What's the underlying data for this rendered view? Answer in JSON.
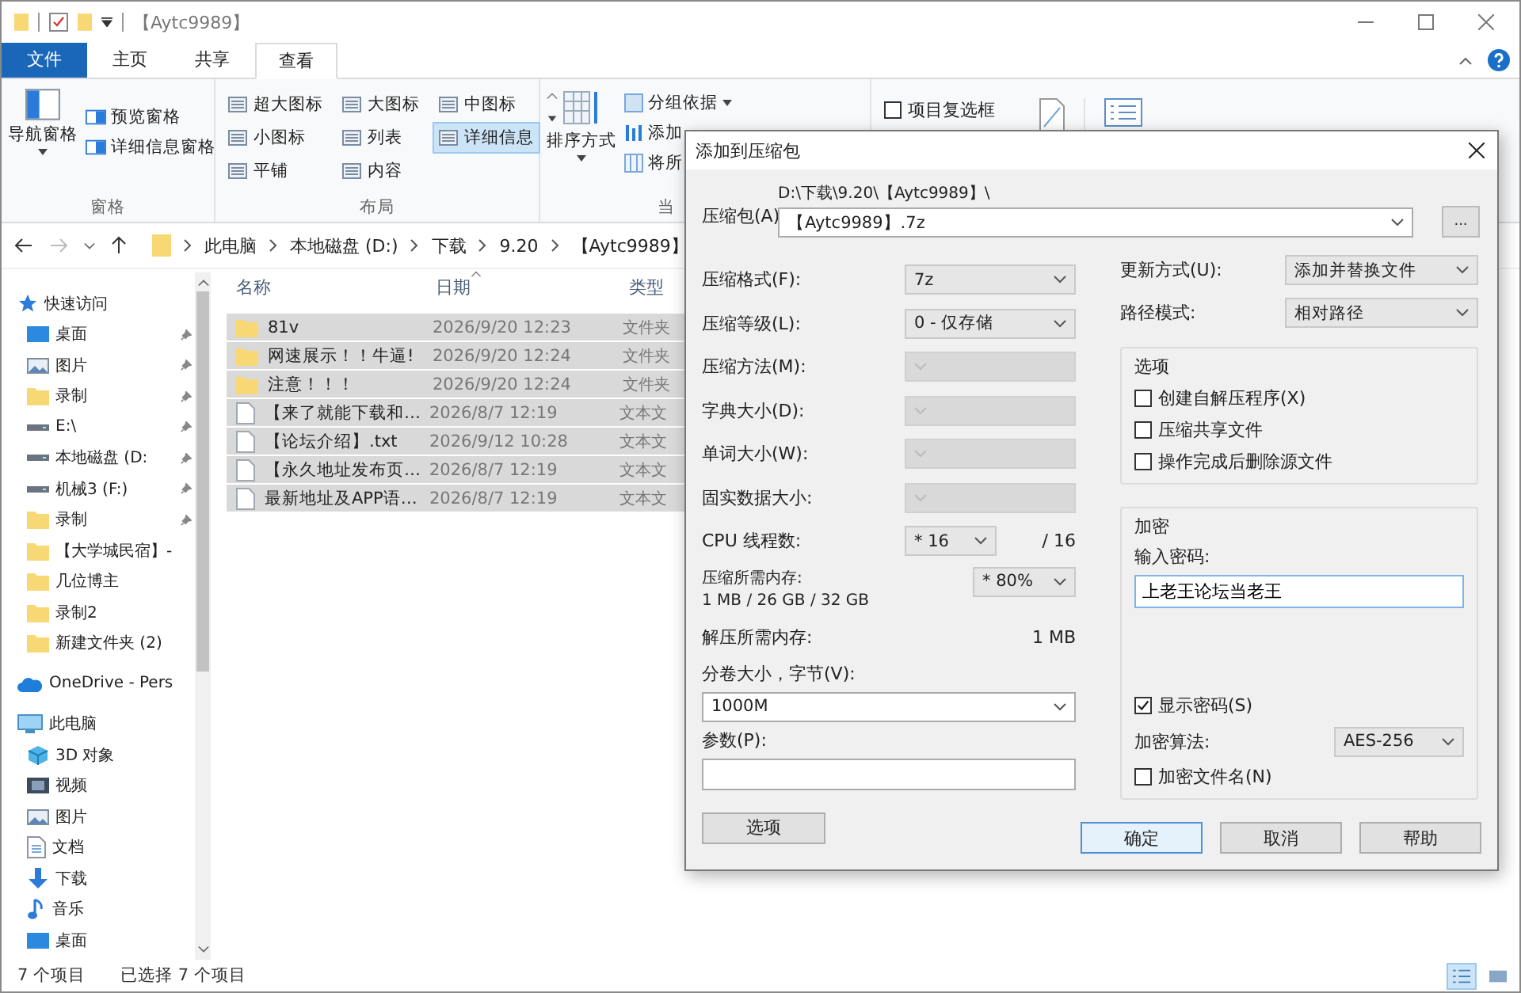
{
  "window": {
    "title": "【Aytc9989】"
  },
  "ribbon_tabs": [
    {
      "label": "文件",
      "selected": false,
      "kind": "file"
    },
    {
      "label": "主页",
      "selected": false,
      "kind": "tab"
    },
    {
      "label": "共享",
      "selected": false,
      "kind": "tab"
    },
    {
      "label": "查看",
      "selected": true,
      "kind": "tab"
    }
  ],
  "ribbon": {
    "pane_group": {
      "label": "窗格",
      "navigation_pane": "导航窗格",
      "preview_pane": "预览窗格",
      "details_pane": "详细信息窗格"
    },
    "layout_group": {
      "label": "布局",
      "options": [
        {
          "label": "超大图标",
          "selected": false
        },
        {
          "label": "大图标",
          "selected": false
        },
        {
          "label": "中图标",
          "selected": false
        },
        {
          "label": "小图标",
          "selected": false
        },
        {
          "label": "列表",
          "selected": false
        },
        {
          "label": "详细信息",
          "selected": true
        },
        {
          "label": "平铺",
          "selected": false
        },
        {
          "label": "内容",
          "selected": false
        }
      ]
    },
    "current_view_group": {
      "label": "当",
      "sort_by": "排序方式",
      "group_by": "分组依据",
      "add_column": "添加",
      "size_columns": "将所"
    },
    "item_checkboxes": {
      "label": "项目复选框",
      "checked": false
    }
  },
  "address_bar": {
    "path": [
      "此电脑",
      "本地磁盘 (D:)",
      "下载",
      "9.20",
      "【Aytc9989】"
    ]
  },
  "navigation_pane": {
    "items": [
      {
        "label": "快速访问",
        "kind": "star",
        "children": [
          {
            "label": "桌面",
            "kind": "desktop",
            "pinned": true
          },
          {
            "label": "图片",
            "kind": "pictures",
            "pinned": true
          },
          {
            "label": "录制",
            "kind": "folder",
            "pinned": true
          },
          {
            "label": "E:\\",
            "kind": "drive",
            "pinned": true
          },
          {
            "label": "本地磁盘 (D:",
            "kind": "drive",
            "pinned": true
          },
          {
            "label": "机械3 (F:)",
            "kind": "drive",
            "pinned": true
          },
          {
            "label": "录制",
            "kind": "folder",
            "pinned": true
          },
          {
            "label": "【大学城民宿】-",
            "kind": "folder",
            "pinned": false
          },
          {
            "label": "几位博主",
            "kind": "folder",
            "pinned": false
          },
          {
            "label": "录制2",
            "kind": "folder",
            "pinned": false
          },
          {
            "label": "新建文件夹 (2)",
            "kind": "folder",
            "pinned": false
          }
        ]
      },
      {
        "label": "OneDrive - Pers",
        "kind": "cloud"
      },
      {
        "label": "此电脑",
        "kind": "pc",
        "children": [
          {
            "label": "3D 对象",
            "kind": "cube"
          },
          {
            "label": "视频",
            "kind": "video"
          },
          {
            "label": "图片",
            "kind": "pictures"
          },
          {
            "label": "文档",
            "kind": "document"
          },
          {
            "label": "下载",
            "kind": "download"
          },
          {
            "label": "音乐",
            "kind": "music"
          },
          {
            "label": "桌面",
            "kind": "desktop"
          }
        ]
      }
    ]
  },
  "file_list": {
    "columns": [
      "名称",
      "日期",
      "类型"
    ],
    "rows": [
      {
        "name": "81v",
        "date": "2026/9/20 12:23",
        "type": "文件夹",
        "kind": "folder",
        "selected": true
      },
      {
        "name": "网速展示！！牛逼!",
        "date": "2026/9/20 12:24",
        "type": "文件夹",
        "kind": "folder",
        "selected": true
      },
      {
        "name": "注意！！！",
        "date": "2026/9/20 12:24",
        "type": "文件夹",
        "kind": "folder",
        "selected": true
      },
      {
        "name": "【来了就能下载和…",
        "date": "2026/8/7 12:19",
        "type": "文本文",
        "kind": "text",
        "selected": true
      },
      {
        "name": "【论坛介绍】.txt",
        "date": "2026/9/12 10:28",
        "type": "文本文",
        "kind": "text",
        "selected": true
      },
      {
        "name": "【永久地址发布页…",
        "date": "2026/8/7 12:19",
        "type": "文本文",
        "kind": "text",
        "selected": true
      },
      {
        "name": "最新地址及APP语…",
        "date": "2026/8/7 12:19",
        "type": "文本文",
        "kind": "text",
        "selected": true
      }
    ]
  },
  "status_bar": {
    "item_count": "7 个项目",
    "selection": "已选择 7 个项目",
    "views": [
      {
        "kind": "details",
        "selected": true
      },
      {
        "kind": "thumbnails",
        "selected": false
      }
    ]
  },
  "dialog": {
    "title": "添加到压缩包",
    "archive": {
      "label": "压缩包(A)",
      "folder": "D:\\下载\\9.20\\【Aytc9989】\\",
      "name": "【Aytc9989】.7z",
      "browse": "..."
    },
    "left_fields": [
      {
        "label": "压缩格式(F):",
        "value": "7z",
        "disabled": false
      },
      {
        "label": "压缩等级(L):",
        "value": "0 - 仅存储",
        "disabled": false
      },
      {
        "label": "压缩方法(M):",
        "disabled": true
      },
      {
        "label": "字典大小(D):",
        "disabled": true
      },
      {
        "label": "单词大小(W):",
        "disabled": true
      },
      {
        "label": "固实数据大小:",
        "disabled": true
      }
    ],
    "cpu_threads": {
      "label": "CPU 线程数:",
      "value": "* 16",
      "max": "/ 16"
    },
    "compress_memory": {
      "label": "压缩所需内存:",
      "detail": "1 MB / 26 GB / 32 GB",
      "value": "* 80%"
    },
    "decompress_memory": {
      "label": "解压所需内存:",
      "value": "1 MB"
    },
    "volume_size": {
      "label": "分卷大小，字节(V):",
      "value": "1000M"
    },
    "parameters": {
      "label": "参数(P):"
    },
    "options_button": "选项",
    "update_mode": {
      "label": "更新方式(U):",
      "value": "添加并替换文件"
    },
    "path_mode": {
      "label": "路径模式:",
      "value": "相对路径"
    },
    "options": {
      "label": "选项",
      "items": [
        {
          "label": "创建自解压程序(X)",
          "checked": false
        },
        {
          "label": "压缩共享文件",
          "checked": false
        },
        {
          "label": "操作完成后删除源文件",
          "checked": false
        }
      ]
    },
    "encryption": {
      "label": "加密",
      "password_label": "输入密码:",
      "password": "上老王论坛当老王",
      "show_password": {
        "label": "显示密码(S)",
        "checked": true
      },
      "method_label": "加密算法:",
      "method": "AES-256",
      "encrypt_names": {
        "label": "加密文件名(N)",
        "checked": false
      }
    },
    "buttons": [
      {
        "label": "确定",
        "default": true
      },
      {
        "label": "取消",
        "default": false
      },
      {
        "label": "帮助",
        "default": false
      }
    ]
  }
}
